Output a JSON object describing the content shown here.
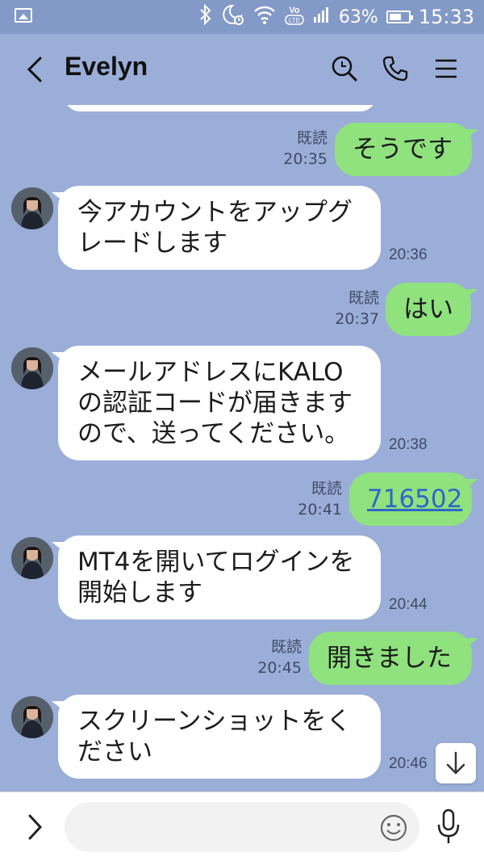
{
  "status": {
    "battery": "63%",
    "time": "15:33",
    "volte": "VoLTE",
    "battery_level": 0.63
  },
  "header": {
    "contact_name": "Evelyn"
  },
  "messages": [
    {
      "dir": "out",
      "text": "そうです",
      "read": "既読",
      "time": "20:35"
    },
    {
      "dir": "in",
      "lines": [
        "今アカウントをアップグ",
        "レードします"
      ],
      "time": "20:36"
    },
    {
      "dir": "out",
      "text": "はい",
      "read": "既読",
      "time": "20:37"
    },
    {
      "dir": "in",
      "lines": [
        "メールアドレスにKALO",
        "の認証コードが届きます",
        "ので、送ってください。"
      ],
      "time": "20:38"
    },
    {
      "dir": "out",
      "text": "716502",
      "read": "既読",
      "time": "20:41"
    },
    {
      "dir": "in",
      "lines": [
        "MT4を開いてログインを",
        "開始します"
      ],
      "time": "20:44"
    },
    {
      "dir": "out",
      "text": "開きました",
      "read": "既読",
      "time": "20:45"
    },
    {
      "dir": "in",
      "lines": [
        "スクリーンショットをく",
        "ださい"
      ],
      "time": "20:46"
    }
  ],
  "input": {
    "placeholder": ""
  },
  "colors": {
    "background": "#9aaed8",
    "outgoing_bubble": "#8fe27e",
    "incoming_bubble": "#ffffff",
    "link": "#2f68c8"
  },
  "icons": [
    "gallery-icon",
    "bluetooth-icon",
    "alarm-icon",
    "wifi-icon",
    "signal-icon",
    "battery-icon",
    "back-icon",
    "search-icon",
    "phone-icon",
    "menu-icon",
    "scroll-down-icon",
    "expand-icon",
    "emoji-icon",
    "mic-icon"
  ]
}
